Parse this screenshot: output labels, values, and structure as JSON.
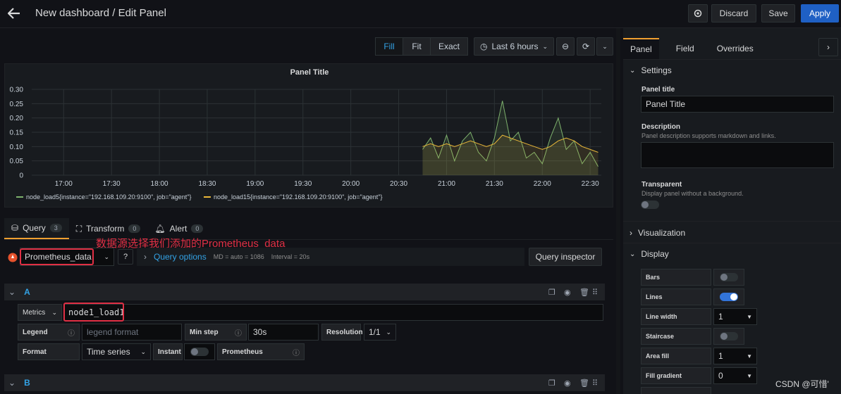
{
  "header": {
    "title": "New dashboard / Edit Panel",
    "discard": "Discard",
    "save": "Save",
    "apply": "Apply"
  },
  "toolbar": {
    "fill": "Fill",
    "fit": "Fit",
    "exact": "Exact",
    "time_range": "Last 6 hours"
  },
  "chart_data": {
    "type": "line",
    "title": "Panel Title",
    "x_ticks": [
      "17:00",
      "17:30",
      "18:00",
      "18:30",
      "19:00",
      "19:30",
      "20:00",
      "20:30",
      "21:00",
      "21:30",
      "22:00",
      "22:30"
    ],
    "y_ticks": [
      "0.30",
      "0.25",
      "0.20",
      "0.15",
      "0.10",
      "0.05",
      "0"
    ],
    "ylim": [
      0,
      0.3
    ],
    "series": [
      {
        "name": "node_load5{instance=\"192.168.109.20:9100\", job=\"agent\"}",
        "color": "#7eb26d",
        "x": [
          "20:45",
          "20:50",
          "20:55",
          "21:00",
          "21:05",
          "21:10",
          "21:15",
          "21:20",
          "21:25",
          "21:30",
          "21:35",
          "21:40",
          "21:45",
          "21:50",
          "21:55",
          "22:00",
          "22:05",
          "22:10",
          "22:15",
          "22:20",
          "22:25",
          "22:30",
          "22:35"
        ],
        "values": [
          0.09,
          0.13,
          0.06,
          0.14,
          0.05,
          0.12,
          0.15,
          0.08,
          0.05,
          0.13,
          0.26,
          0.12,
          0.15,
          0.06,
          0.08,
          0.04,
          0.13,
          0.2,
          0.09,
          0.12,
          0.04,
          0.08,
          0.03
        ]
      },
      {
        "name": "node_load15{instance=\"192.168.109.20:9100\", job=\"agent\"}",
        "color": "#eab839",
        "x": [
          "20:45",
          "20:50",
          "20:55",
          "21:00",
          "21:05",
          "21:10",
          "21:15",
          "21:20",
          "21:25",
          "21:30",
          "21:35",
          "21:40",
          "21:45",
          "21:50",
          "21:55",
          "22:00",
          "22:05",
          "22:10",
          "22:15",
          "22:20",
          "22:25",
          "22:30",
          "22:35"
        ],
        "values": [
          0.1,
          0.11,
          0.1,
          0.11,
          0.1,
          0.11,
          0.12,
          0.11,
          0.1,
          0.11,
          0.14,
          0.13,
          0.12,
          0.11,
          0.1,
          0.09,
          0.1,
          0.12,
          0.13,
          0.12,
          0.1,
          0.09,
          0.08
        ]
      }
    ],
    "legend_position": "bottom-left",
    "grid": true
  },
  "query_tabs": [
    {
      "label": "Query",
      "count": "3"
    },
    {
      "label": "Transform",
      "count": "0"
    },
    {
      "label": "Alert",
      "count": "0"
    }
  ],
  "datasource": {
    "name": "Prometheus_data",
    "annotation": "数据源选择我们添加的Prometheus_data",
    "query_options": "Query options",
    "md": "MD = auto = 1086",
    "interval": "Interval = 20s",
    "inspector": "Query inspector"
  },
  "query_a": {
    "letter": "A",
    "metrics_label": "Metrics",
    "metrics_value": "node1_load1",
    "legend_label": "Legend",
    "legend_placeholder": "legend format",
    "min_step_label": "Min step",
    "min_step_value": "30s",
    "resolution_label": "Resolution",
    "resolution_value": "1/1",
    "format_label": "Format",
    "format_value": "Time series",
    "instant_label": "Instant",
    "prometheus_label": "Prometheus"
  },
  "query_b": {
    "letter": "B"
  },
  "right_panel": {
    "tabs": [
      "Panel",
      "Field",
      "Overrides"
    ],
    "settings": "Settings",
    "panel_title_label": "Panel title",
    "panel_title_value": "Panel Title",
    "description_label": "Description",
    "description_hint": "Panel description supports markdown and links.",
    "transparent_label": "Transparent",
    "transparent_hint": "Display panel without a background.",
    "visualization": "Visualization",
    "display": "Display",
    "bars": "Bars",
    "lines": "Lines",
    "line_width": "Line width",
    "line_width_value": "1",
    "staircase": "Staircase",
    "area_fill": "Area fill",
    "area_fill_value": "1",
    "fill_gradient": "Fill gradient",
    "fill_gradient_value": "0"
  },
  "watermark": "CSDN @可惜'"
}
